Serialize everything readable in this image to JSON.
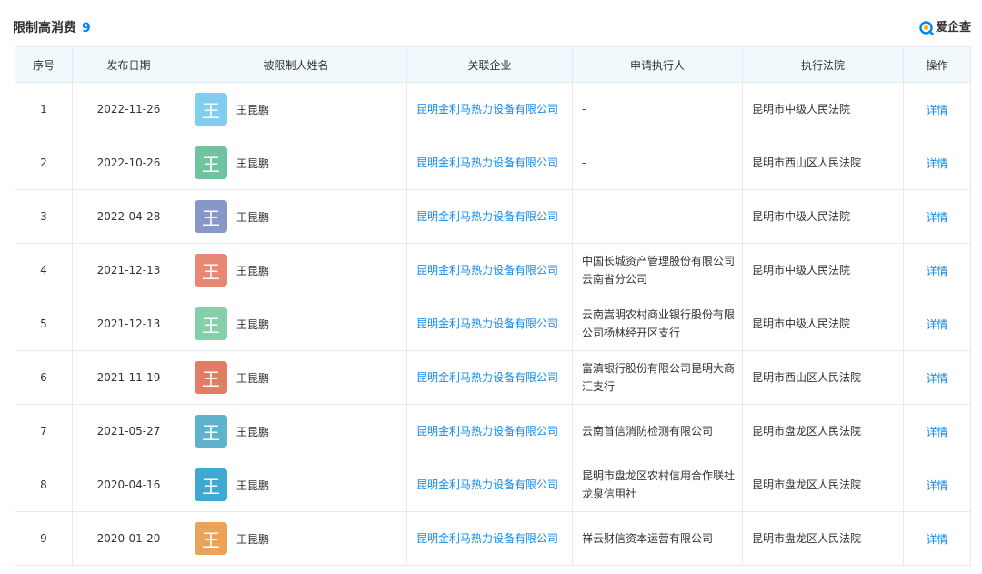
{
  "header": {
    "title": "限制高消费",
    "count": "9",
    "brand_text": "爱企查"
  },
  "colors": {
    "accent": "#0084ff",
    "link": "#128bed",
    "header_bg": "#f2f9fc",
    "border": "#e4eaf3"
  },
  "table": {
    "columns": [
      "序号",
      "发布日期",
      "被限制人姓名",
      "关联企业",
      "申请执行人",
      "执行法院",
      "操作"
    ],
    "rows": [
      {
        "no": "1",
        "date": "2022-11-26",
        "avatar_char": "王",
        "avatar_color": "#7fcef0",
        "name": "王昆鹏",
        "company": "昆明金利马热力设备有限公司",
        "applicant": "-",
        "court": "昆明市中级人民法院",
        "action": "详情"
      },
      {
        "no": "2",
        "date": "2022-10-26",
        "avatar_char": "王",
        "avatar_color": "#6fc39e",
        "name": "王昆鹏",
        "company": "昆明金利马热力设备有限公司",
        "applicant": "-",
        "court": "昆明市西山区人民法院",
        "action": "详情"
      },
      {
        "no": "3",
        "date": "2022-04-28",
        "avatar_char": "王",
        "avatar_color": "#8797c7",
        "name": "王昆鹏",
        "company": "昆明金利马热力设备有限公司",
        "applicant": "-",
        "court": "昆明市中级人民法院",
        "action": "详情"
      },
      {
        "no": "4",
        "date": "2021-12-13",
        "avatar_char": "王",
        "avatar_color": "#e88872",
        "name": "王昆鹏",
        "company": "昆明金利马热力设备有限公司",
        "applicant": "中国长城资产管理股份有限公司云南省分公司",
        "court": "昆明市中级人民法院",
        "action": "详情"
      },
      {
        "no": "5",
        "date": "2021-12-13",
        "avatar_char": "王",
        "avatar_color": "#84d0a9",
        "name": "王昆鹏",
        "company": "昆明金利马热力设备有限公司",
        "applicant": "云南嵩明农村商业银行股份有限公司杨林经开区支行",
        "court": "昆明市中级人民法院",
        "action": "详情"
      },
      {
        "no": "6",
        "date": "2021-11-19",
        "avatar_char": "王",
        "avatar_color": "#e37c65",
        "name": "王昆鹏",
        "company": "昆明金利马热力设备有限公司",
        "applicant": "富滇银行股份有限公司昆明大商汇支行",
        "court": "昆明市西山区人民法院",
        "action": "详情"
      },
      {
        "no": "7",
        "date": "2021-05-27",
        "avatar_char": "王",
        "avatar_color": "#5fb2cb",
        "name": "王昆鹏",
        "company": "昆明金利马热力设备有限公司",
        "applicant": "云南首信消防检测有限公司",
        "court": "昆明市盘龙区人民法院",
        "action": "详情"
      },
      {
        "no": "8",
        "date": "2020-04-16",
        "avatar_char": "王",
        "avatar_color": "#3eaad3",
        "name": "王昆鹏",
        "company": "昆明金利马热力设备有限公司",
        "applicant": "昆明市盘龙区农村信用合作联社龙泉信用社",
        "court": "昆明市盘龙区人民法院",
        "action": "详情"
      },
      {
        "no": "9",
        "date": "2020-01-20",
        "avatar_char": "王",
        "avatar_color": "#eba35c",
        "name": "王昆鹏",
        "company": "昆明金利马热力设备有限公司",
        "applicant": "祥云财信资本运营有限公司",
        "court": "昆明市盘龙区人民法院",
        "action": "详情"
      }
    ]
  }
}
